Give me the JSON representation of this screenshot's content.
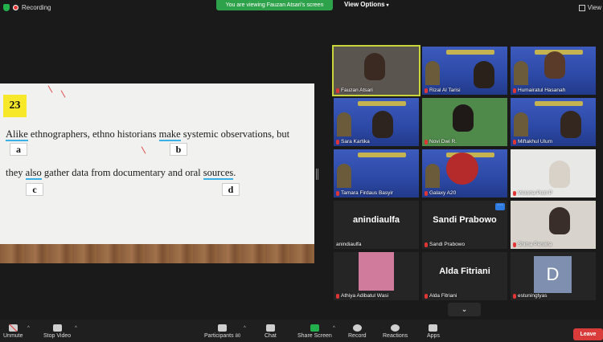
{
  "topbar": {
    "recording_label": "Recording",
    "banner": "You are viewing Fauzan Atsari's screen",
    "view_options": "View Options",
    "view_label": "View"
  },
  "slide": {
    "number": "23",
    "line1_pre": "",
    "line1_a": "Alike",
    "line1_mid": " ethnographers, ethno historians ",
    "line1_b": "make",
    "line1_post": " systemic observations, but",
    "line2_pre": "they ",
    "line2_c": "also",
    "line2_mid": " gather data from documentary and oral ",
    "line2_d": "sources",
    "line2_post": ".",
    "labels": {
      "a": "a",
      "b": "b",
      "c": "c",
      "d": "d"
    }
  },
  "participants": [
    {
      "name": "Fauzan Atsari",
      "active": true
    },
    {
      "name": "Rizal Al Tarisi"
    },
    {
      "name": "Humairatul Hasanah"
    },
    {
      "name": "Sara Kartika"
    },
    {
      "name": "Novi Dwi R."
    },
    {
      "name": "Miftakhul Ulum"
    },
    {
      "name": "Tamara Firdaus Basyir"
    },
    {
      "name": "Galaxy A20"
    },
    {
      "name": "Victoria Putri P"
    },
    {
      "name": "anindiaulfa",
      "display": "anindiaulfa"
    },
    {
      "name": "Sandi Prabowo",
      "display": "Sandi Prabowo"
    },
    {
      "name": "Shima Perwira"
    },
    {
      "name": "Athiya Adibatul Wasi"
    },
    {
      "name": "Alda Fitriani",
      "display": "Alda Fitriani"
    },
    {
      "name": "estuningtyas",
      "avatar": "D"
    }
  ],
  "toolbar": {
    "unmute": "Unmute",
    "stop_video": "Stop Video",
    "participants": "Participants",
    "participants_count": "80",
    "chat": "Chat",
    "share_screen": "Share Screen",
    "record": "Record",
    "reactions": "Reactions",
    "apps": "Apps",
    "leave": "Leave"
  },
  "colors": {
    "banner_green": "#2ea24a",
    "leave_red": "#d93b3b",
    "active_border": "#c9d43a",
    "underline_blue": "#3ab0e6",
    "number_yellow": "#f7e92a"
  }
}
